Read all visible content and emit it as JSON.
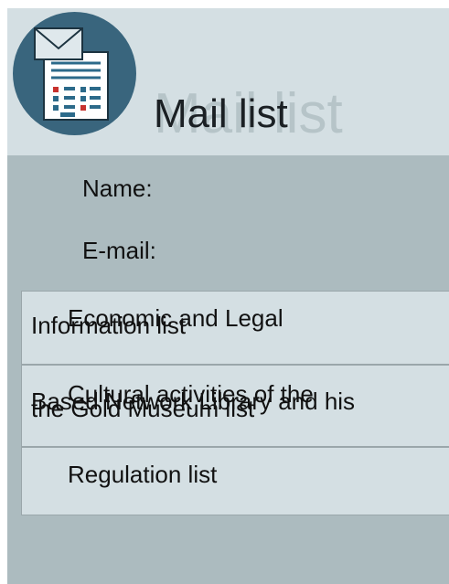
{
  "header": {
    "title": "Mail list",
    "title_shadow": "Mail list"
  },
  "form": {
    "name_label": "Name:",
    "email_label": "E-mail:"
  },
  "list": {
    "items": [
      {
        "text_a": "Information list",
        "text_b": "Economic and Legal"
      },
      {
        "text_a": "Cultural activities of the",
        "text_b": "Based Network Library and his",
        "text_c": "the Gold Museum list"
      },
      {
        "text_a": "Regulation list"
      }
    ]
  },
  "colors": {
    "header_bg": "#d4dfe3",
    "body_bg": "#acbbbf",
    "logo_circle": "#39657d"
  },
  "icons": {
    "logo": "envelope-form-icon"
  }
}
